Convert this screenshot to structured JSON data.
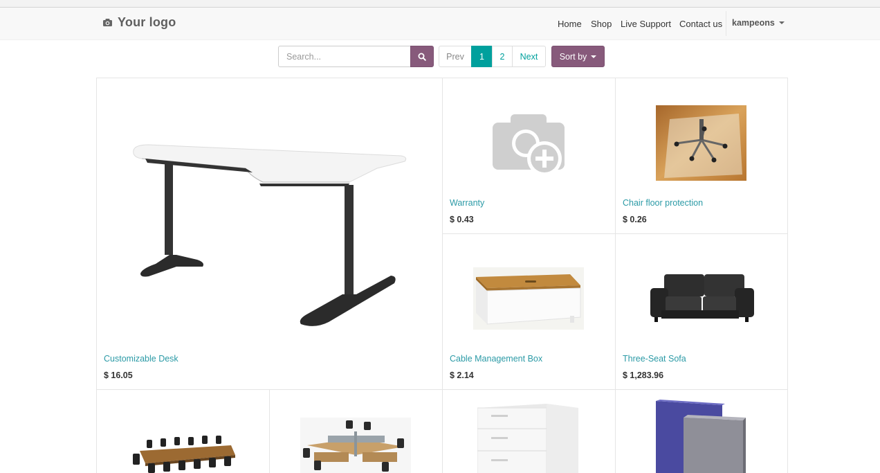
{
  "header": {
    "logo_text": "Your logo",
    "nav": {
      "home": "Home",
      "shop": "Shop",
      "support": "Live Support",
      "contact": "Contact us",
      "user": "kampeons"
    }
  },
  "toolbar": {
    "search_placeholder": "Search...",
    "pager": {
      "prev": "Prev",
      "page1": "1",
      "page2": "2",
      "next": "Next"
    },
    "sort_label": "Sort by"
  },
  "products": [
    {
      "name": "Customizable Desk",
      "price": "$ 16.05"
    },
    {
      "name": "Warranty",
      "price": "$ 0.43"
    },
    {
      "name": "Chair floor protection",
      "price": "$ 0.26"
    },
    {
      "name": "Cable Management Box",
      "price": "$ 2.14"
    },
    {
      "name": "Three-Seat Sofa",
      "price": "$ 1,283.96"
    }
  ],
  "colors": {
    "primary": "#875a7b",
    "accent": "#00a09d",
    "link": "#2b9aa6"
  }
}
